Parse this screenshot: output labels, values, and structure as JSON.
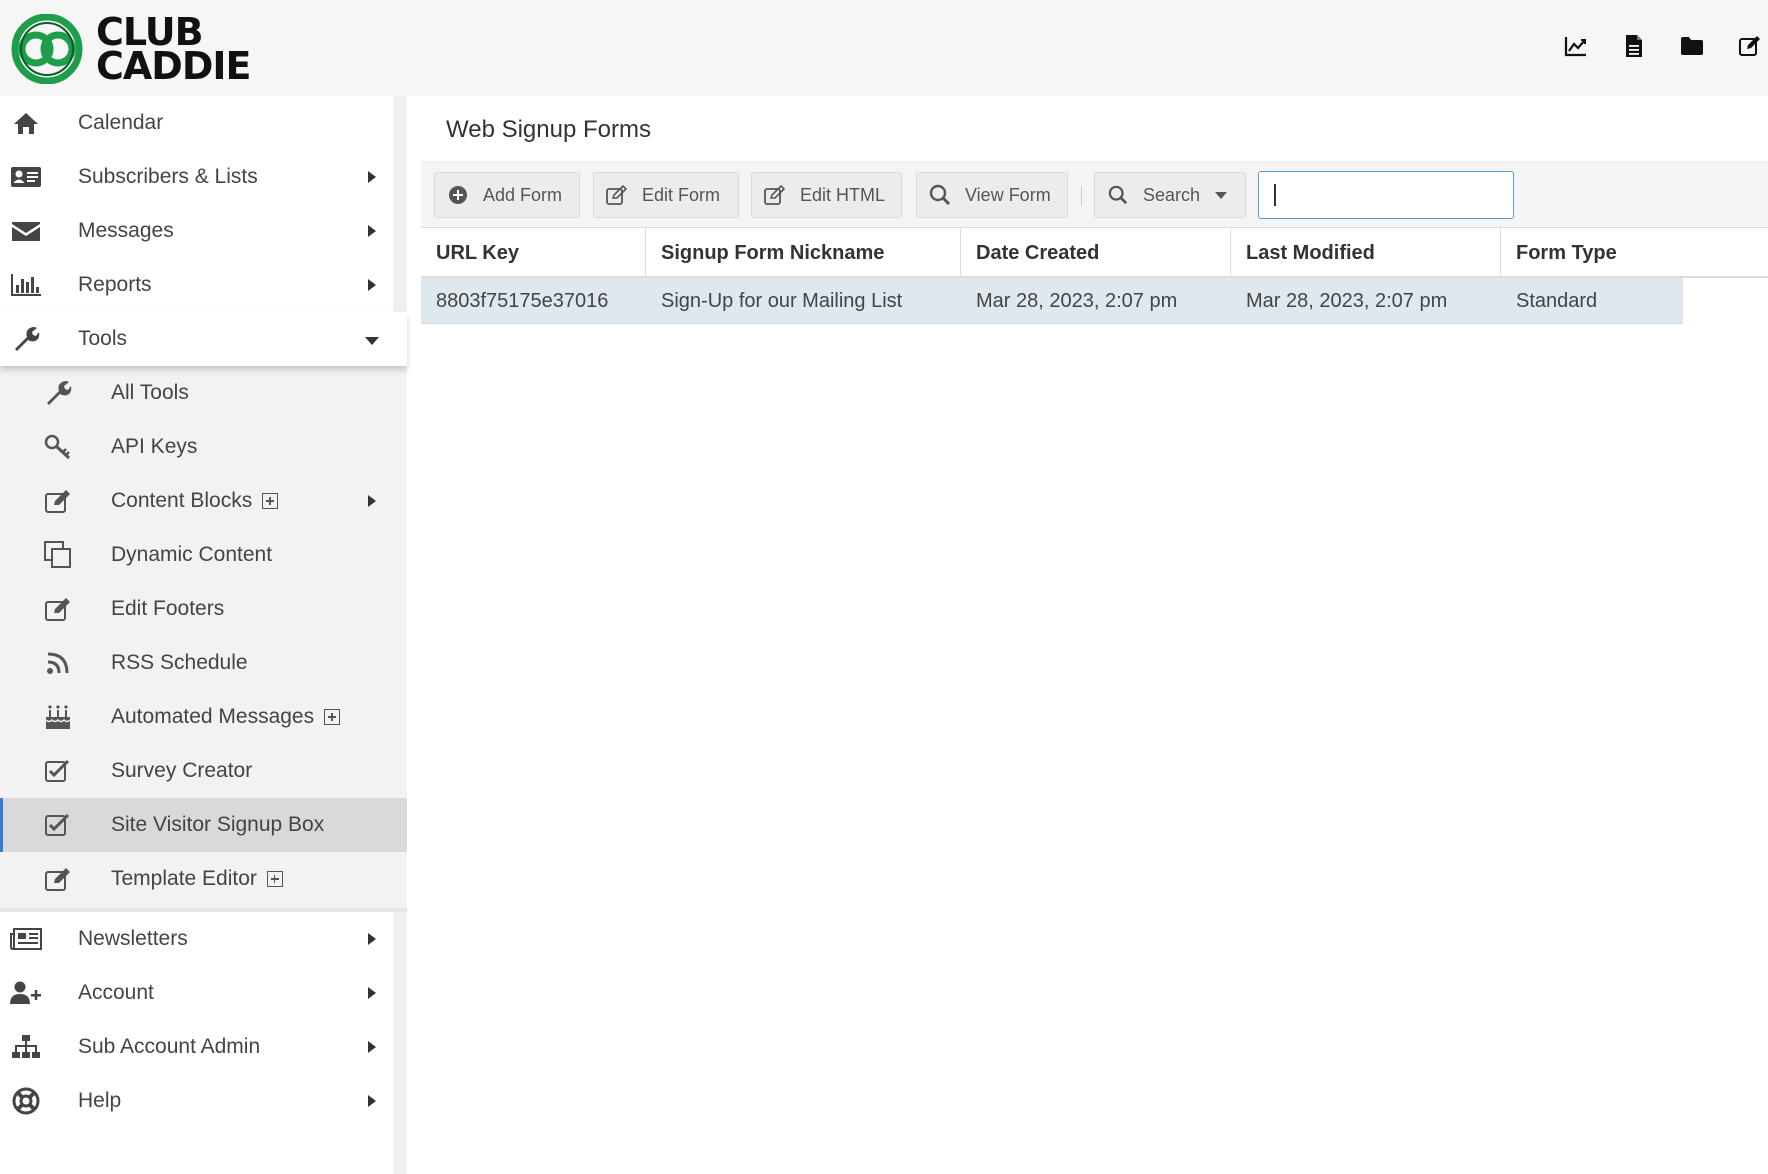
{
  "header": {
    "logo_text_line1": "CLUB",
    "logo_text_line2": "CADDIE",
    "icons": [
      "line-chart-icon",
      "document-icon",
      "folder-icon",
      "edit-icon"
    ]
  },
  "sidebar": {
    "items_top": [
      {
        "label": "Calendar",
        "icon": "home-icon",
        "has_caret": false
      },
      {
        "label": "Subscribers & Lists",
        "icon": "contact-card-icon",
        "has_caret": true
      },
      {
        "label": "Messages",
        "icon": "envelope-icon",
        "has_caret": true
      },
      {
        "label": "Reports",
        "icon": "bar-chart-icon",
        "has_caret": true
      },
      {
        "label": "Tools",
        "icon": "wrench-icon",
        "has_caret": true,
        "expanded": true
      }
    ],
    "tools_submenu": [
      {
        "label": "All Tools",
        "icon": "wrench-icon"
      },
      {
        "label": "API Keys",
        "icon": "key-icon"
      },
      {
        "label": "Content Blocks",
        "icon": "edit-icon",
        "plus": true,
        "caret": true
      },
      {
        "label": "Dynamic Content",
        "icon": "copy-icon"
      },
      {
        "label": "Edit Footers",
        "icon": "edit-icon"
      },
      {
        "label": "RSS Schedule",
        "icon": "rss-icon"
      },
      {
        "label": "Automated Messages",
        "icon": "birthday-cake-icon",
        "plus": true
      },
      {
        "label": "Survey Creator",
        "icon": "checkbox-icon"
      },
      {
        "label": "Site Visitor Signup Box",
        "icon": "checkbox-icon",
        "active": true
      },
      {
        "label": "Template Editor",
        "icon": "edit-icon",
        "plus": true
      }
    ],
    "items_bottom": [
      {
        "label": "Newsletters",
        "icon": "newspaper-icon",
        "has_caret": true
      },
      {
        "label": "Account",
        "icon": "user-plus-icon",
        "has_caret": true
      },
      {
        "label": "Sub Account Admin",
        "icon": "sitemap-icon",
        "has_caret": true
      },
      {
        "label": "Help",
        "icon": "life-ring-icon",
        "has_caret": true
      }
    ]
  },
  "main": {
    "title": "Web Signup Forms",
    "toolbar": {
      "add_form": "Add Form",
      "edit_form": "Edit Form",
      "edit_html": "Edit HTML",
      "view_form": "View Form",
      "search": "Search",
      "search_value": ""
    },
    "table": {
      "columns": [
        "URL Key",
        "Signup Form Nickname",
        "Date Created",
        "Last Modified",
        "Form Type"
      ],
      "rows": [
        [
          "8803f75175e37016",
          "Sign-Up for our Mailing List",
          "Mar 28, 2023, 2:07 pm",
          "Mar 28, 2023, 2:07 pm",
          "Standard"
        ]
      ]
    }
  },
  "colors": {
    "logo_green": "#1e9e4a",
    "selected_row": "#dfe7ef",
    "active_sidebar": "#d9d9d9",
    "search_border": "#5b9bd5"
  }
}
